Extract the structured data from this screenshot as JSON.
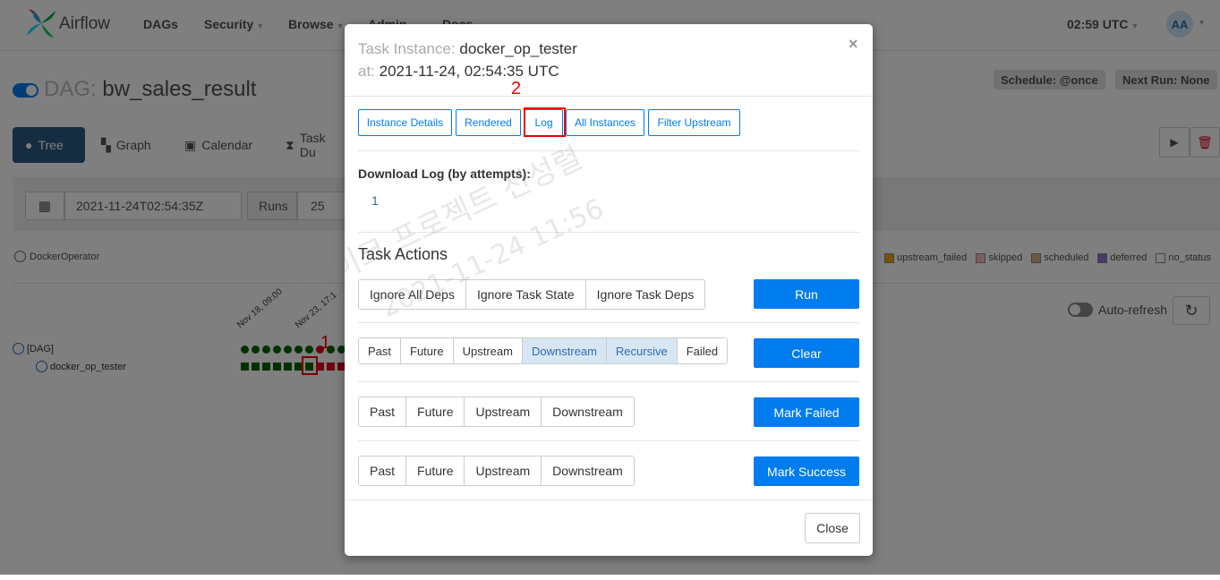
{
  "nav": {
    "brand": "Airflow",
    "items": [
      "DAGs",
      "Security",
      "Browse",
      "Admin",
      "Docs"
    ],
    "clock": "02:59 UTC",
    "avatar": "AA"
  },
  "dag": {
    "prefix": "DAG:",
    "name": "bw_sales_result",
    "schedule": "Schedule: @once",
    "next_run": "Next Run: None"
  },
  "tabs": [
    "Tree",
    "Graph",
    "Calendar",
    "Task Du"
  ],
  "filter": {
    "date": "2021-11-24T02:54:35Z",
    "runs_label": "Runs",
    "runs_value": "25"
  },
  "legend": {
    "operator": "DockerOperator",
    "states": [
      {
        "label": "upstream_failed",
        "color": "#f0a30a"
      },
      {
        "label": "skipped",
        "color": "#ffb6c1"
      },
      {
        "label": "scheduled",
        "color": "#d2b48c"
      },
      {
        "label": "deferred",
        "color": "#9370db"
      },
      {
        "label": "no_status",
        "color": "#ffffff"
      }
    ]
  },
  "auto_refresh": "Auto-refresh",
  "tree": {
    "root": "[DAG]",
    "task": "docker_op_tester",
    "dates": [
      "Nov 18, 09:00",
      "Nov 23, 17:1"
    ]
  },
  "annotations": {
    "first": "1",
    "second": "2"
  },
  "modal": {
    "title_label": "Task Instance:",
    "title_value": "docker_op_tester",
    "at_label": "at:",
    "at_value": "2021-11-24, 02:54:35 UTC",
    "close_symbol": "×",
    "nav_buttons": [
      "Instance Details",
      "Rendered",
      "Log",
      "All Instances",
      "Filter Upstream"
    ],
    "download_log_label": "Download Log (by attempts):",
    "attempt": "1",
    "task_actions_title": "Task Actions",
    "run_options": [
      "Ignore All Deps",
      "Ignore Task State",
      "Ignore Task Deps"
    ],
    "run_button": "Run",
    "clear_options": [
      "Past",
      "Future",
      "Upstream",
      "Downstream",
      "Recursive",
      "Failed"
    ],
    "clear_button": "Clear",
    "mark_failed_options": [
      "Past",
      "Future",
      "Upstream",
      "Downstream"
    ],
    "mark_failed_button": "Mark Failed",
    "mark_success_options": [
      "Past",
      "Future",
      "Upstream",
      "Downstream"
    ],
    "mark_success_button": "Mark Success",
    "close_button": "Close"
  },
  "colors": {
    "accent": "#017cee",
    "success": "#006400",
    "failed": "#d9001d",
    "annotation": "#e00000"
  }
}
